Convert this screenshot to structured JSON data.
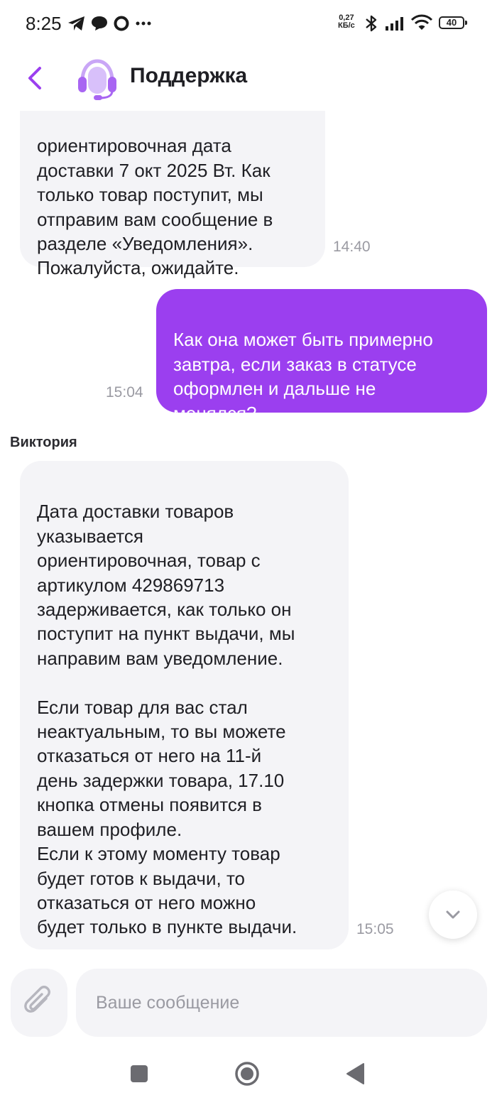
{
  "status_bar": {
    "time": "8:25",
    "net_speed_value": "0,27",
    "net_speed_unit": "КБ/с",
    "battery": "40",
    "icons": [
      "telegram-icon",
      "messages-icon",
      "circle-icon",
      "more-dots-icon",
      "bluetooth-icon",
      "signal-icon",
      "wifi-icon",
      "battery-icon"
    ]
  },
  "header": {
    "title": "Поддержка",
    "back_icon": "chevron-left-icon",
    "avatar_icon": "headset-icon",
    "accent_color": "#9b3fef"
  },
  "messages": [
    {
      "direction": "incoming",
      "text": "ориентировочная дата\nдоставки 7 окт 2025 Вт. Как\nтолько товар поступит, мы\nотправим вам сообщение в\nразделе «Уведомления».\nПожалуйста, ожидайте.",
      "time": "14:40"
    },
    {
      "direction": "outgoing",
      "text": "Как она может быть примерно\nзавтра, если заказ в статусе\nоформлен и дальше не\nменялся?",
      "time": "15:04"
    },
    {
      "direction": "incoming",
      "sender": "Виктория",
      "text": "Дата доставки товаров\nуказывается\nориентировочная, товар с\nартикулом 429869713\nзадерживается, как только он\nпоступит на пункт выдачи, мы\nнаправим вам уведомление.\n\nЕсли товар для вас стал\nнеактуальным, то вы можете\nотказаться от него на 11-й\nдень задержки товара, 17.10\nкнопка отмены появится в\nвашем профиле.\nЕсли к этому моменту товар\nбудет готов к выдачи, то\nотказаться от него можно\nбудет только в пункте выдачи.",
      "time": "15:05"
    }
  ],
  "composer": {
    "placeholder": "Ваше сообщение",
    "value": "",
    "attach_icon": "paperclip-icon"
  },
  "scroll_down_icon": "chevron-down-icon",
  "nav_bar": {
    "icons": [
      "recents-square-icon",
      "home-circle-icon",
      "back-triangle-icon"
    ]
  }
}
